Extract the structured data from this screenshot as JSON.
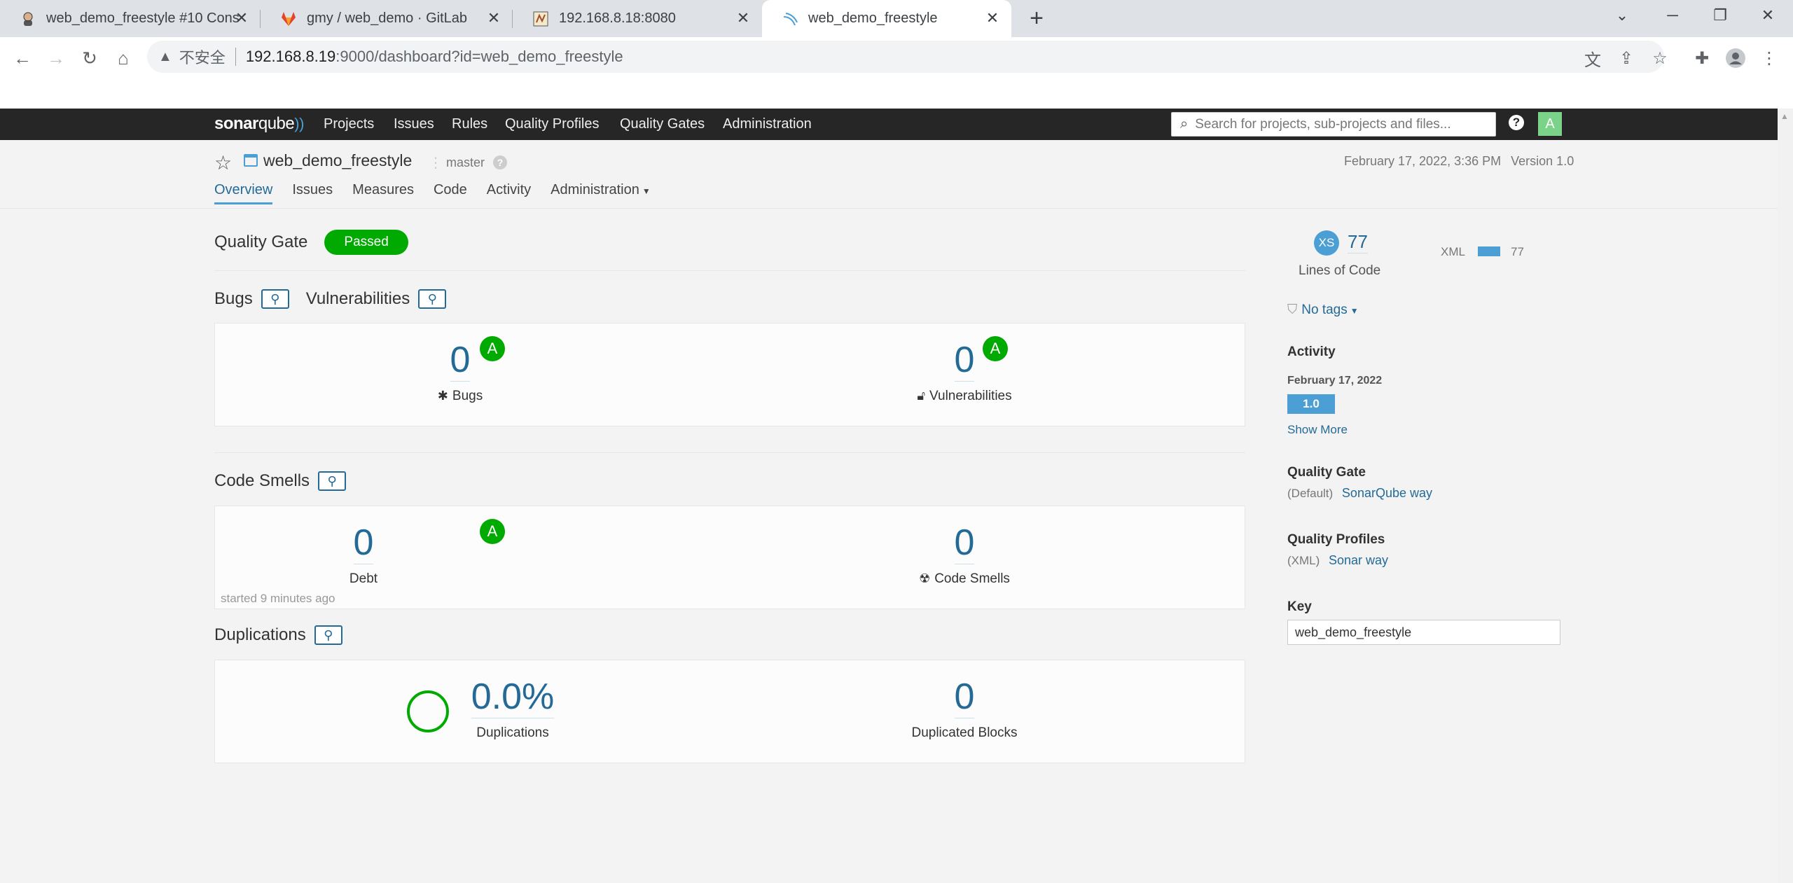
{
  "browser": {
    "tabs": [
      {
        "title": "web_demo_freestyle #10 Cons",
        "icon": "jenkins-icon"
      },
      {
        "title": "gmy / web_demo · GitLab",
        "icon": "gitlab-icon"
      },
      {
        "title": "192.168.8.18:8080",
        "icon": "tomcat-icon"
      },
      {
        "title": "web_demo_freestyle",
        "icon": "sonarqube-icon"
      }
    ],
    "insecure_label": "不安全",
    "url_host": "192.168.8.19",
    "url_path": ":9000/dashboard?id=web_demo_freestyle"
  },
  "sonar_nav": {
    "logo_bold": "sonar",
    "logo_light": "qube",
    "menu": [
      "Projects",
      "Issues",
      "Rules",
      "Quality Profiles",
      "Quality Gates",
      "Administration"
    ],
    "search_placeholder": "Search for projects, sub-projects and files...",
    "help": "?",
    "avatar": "A"
  },
  "project": {
    "name": "web_demo_freestyle",
    "branch": "master",
    "date": "February 17, 2022, 3:36 PM",
    "version": "Version 1.0",
    "tabs": [
      "Overview",
      "Issues",
      "Measures",
      "Code",
      "Activity",
      "Administration"
    ]
  },
  "overview": {
    "quality_gate_label": "Quality Gate",
    "quality_gate_status": "Passed",
    "bugs_title": "Bugs",
    "vulns_title": "Vulnerabilities",
    "bugs_value": "0",
    "bugs_rating": "A",
    "bugs_label": "Bugs",
    "vulns_value": "0",
    "vulns_rating": "A",
    "vulns_label": "Vulnerabilities",
    "smells_title": "Code Smells",
    "debt_value": "0",
    "debt_rating": "A",
    "debt_label": "Debt",
    "smells_value": "0",
    "smells_label": "Code Smells",
    "started": "started 9 minutes ago",
    "dup_title": "Duplications",
    "dup_value": "0.0%",
    "dup_label": "Duplications",
    "dup_blocks_value": "0",
    "dup_blocks_label": "Duplicated Blocks"
  },
  "sidebar": {
    "size_badge": "XS",
    "loc_value": "77",
    "loc_label": "Lines of Code",
    "lang_name": "XML",
    "lang_value": "77",
    "tags": "No tags",
    "activity_title": "Activity",
    "activity_date": "February 17, 2022",
    "activity_version": "1.0",
    "show_more": "Show More",
    "qg_title": "Quality Gate",
    "qg_default": "(Default)",
    "qg_link": "SonarQube way",
    "qp_title": "Quality Profiles",
    "qp_lang": "(XML)",
    "qp_link": "Sonar way",
    "key_title": "Key",
    "key_value": "web_demo_freestyle"
  },
  "colors": {
    "passed": "#00aa00",
    "accent": "#236a97",
    "brand_blue": "#4b9fd5",
    "nav_bg": "#262626"
  }
}
